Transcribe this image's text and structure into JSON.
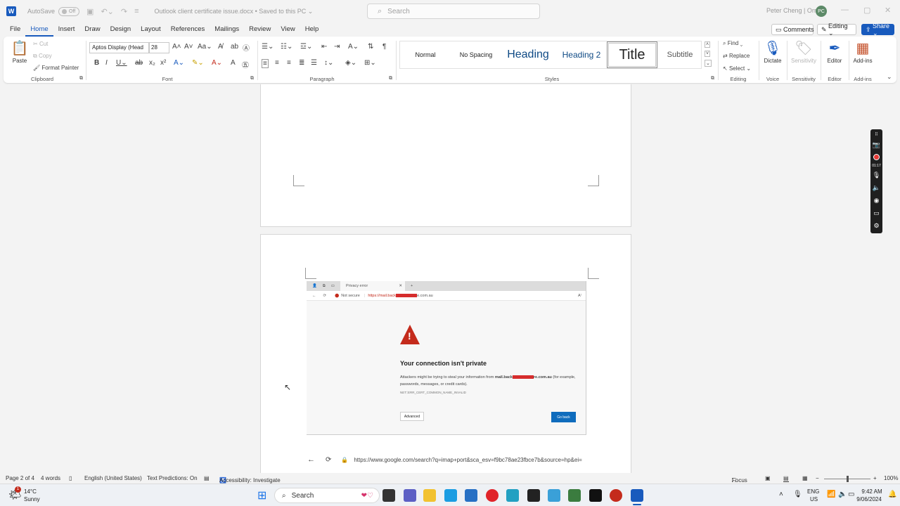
{
  "titlebar": {
    "app_logo": "W",
    "autosave_label": "AutoSave",
    "autosave_state": "Off",
    "doc_title": "Outlook client certificate issue.docx  •  Saved to this PC ⌄",
    "search_placeholder": "Search",
    "user_name": "Peter Cheng | Orro",
    "avatar_initials": "PC"
  },
  "tabs": [
    "File",
    "Home",
    "Insert",
    "Draw",
    "Design",
    "Layout",
    "References",
    "Mailings",
    "Review",
    "View",
    "Help"
  ],
  "ribbon_right": {
    "comments": "Comments",
    "editing": "Editing ⌄",
    "share": "Share ⌄"
  },
  "clipboard": {
    "paste": "Paste",
    "cut": "Cut",
    "copy": "Copy",
    "format_painter": "Format Painter",
    "label": "Clipboard"
  },
  "font": {
    "family": "Aptos Display (Head",
    "size": "28",
    "label": "Font"
  },
  "paragraph": {
    "label": "Paragraph"
  },
  "styles": {
    "items": [
      "Normal",
      "No Spacing",
      "Heading",
      "Heading 2",
      "Title",
      "Subtitle"
    ],
    "label": "Styles"
  },
  "editing": {
    "find": "Find ⌄",
    "replace": "Replace",
    "select": "Select ⌄",
    "label": "Editing"
  },
  "voice": {
    "dictate": "Dictate",
    "label": "Voice"
  },
  "sensitivity": {
    "button": "Sensitivity",
    "label": "Sensitivity"
  },
  "editor": {
    "button": "Editor",
    "label": "Editor"
  },
  "addins": {
    "button": "Add-ins",
    "label": "Add-ins"
  },
  "screenshot": {
    "tab_title": "Privacy error",
    "not_secure": "Not secure",
    "url_prefix": "https://mail.back",
    "url_suffix": "e.com.au",
    "heading": "Your connection isn't private",
    "body_prefix": "Attackers might be trying to steal your information from ",
    "body_host_prefix": "mail.back",
    "body_host_suffix": "re.com.au",
    "body_suffix": " (for example, passwords, messages, or credit cards).",
    "error_code": "NET::ERR_CERT_COMMON_NAME_INVALID",
    "advanced": "Advanced",
    "go_back": "Go back"
  },
  "google_url": "https://www.google.com/search?q=imap+port&sca_esv=f9bc78ae23fbce7b&source=hp&ei=",
  "recorder_time": "01:17",
  "statusbar": {
    "page": "Page 2 of 4",
    "words": "4 words",
    "language": "English (United States)",
    "text_predictions": "Text Predictions: On",
    "accessibility": "Accessibility: Investigate",
    "focus": "Focus",
    "zoom": "100%"
  },
  "taskbar": {
    "temp": "14°C",
    "weather": "Sunny",
    "weather_badge": "1",
    "search": "Search",
    "lang_top": "ENG",
    "lang_bottom": "US",
    "time": "9:42 AM",
    "date": "9/06/2024"
  }
}
